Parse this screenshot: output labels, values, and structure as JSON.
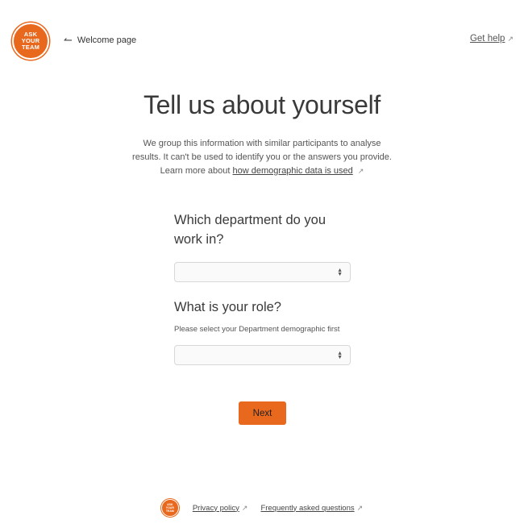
{
  "header": {
    "logo_lines": [
      "ASK",
      "YOUR",
      "TEAM"
    ],
    "back_label": "Welcome page",
    "help_label": "Get help"
  },
  "main": {
    "title": "Tell us about yourself",
    "intro_line1": "We group this information with similar participants to analyse",
    "intro_line2": "results. It can't be used to identify you or the answers you provide.",
    "intro_line3_prefix": "Learn more about",
    "intro_link": "how demographic data is used"
  },
  "form": {
    "department_question": "Which department do you work in?",
    "department_value": "",
    "role_question": "What is your role?",
    "role_hint": "Please select your Department demographic first",
    "role_value": "",
    "next_label": "Next"
  },
  "footer": {
    "privacy_label": "Privacy policy",
    "faq_label": "Frequently asked questions"
  },
  "colors": {
    "accent": "#e8681d",
    "text": "#333333",
    "muted": "#555555"
  }
}
